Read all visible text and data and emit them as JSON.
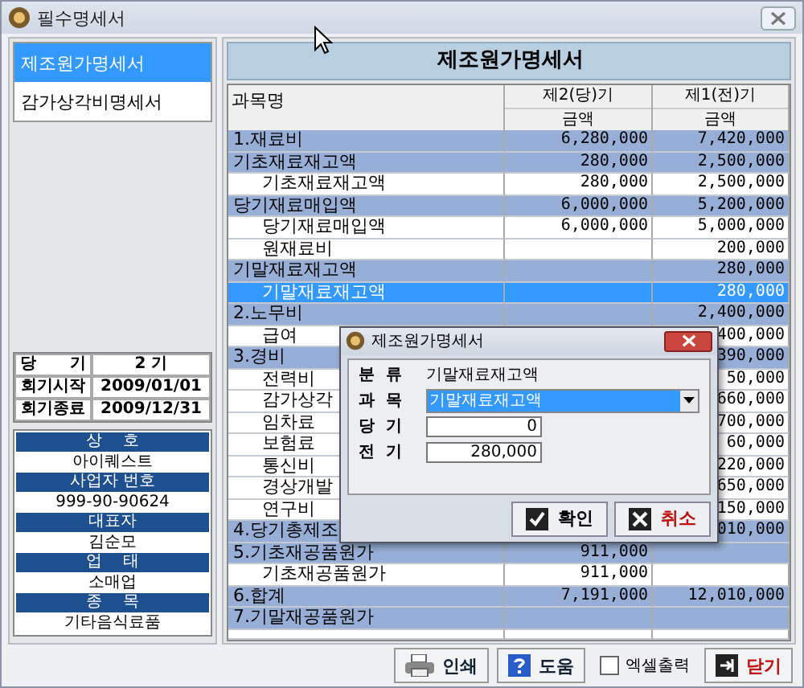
{
  "window": {
    "title": "필수명세서"
  },
  "statements": [
    {
      "label": "제조원가명세서",
      "selected": true
    },
    {
      "label": "감가상각비명세서",
      "selected": false
    }
  ],
  "period": [
    {
      "label": "당      기",
      "value": "2 기"
    },
    {
      "label": "회기시작",
      "value": "2009/01/01"
    },
    {
      "label": "회기종료",
      "value": "2009/12/31"
    }
  ],
  "company": [
    {
      "heading": "상    호",
      "value": "아이퀘스트"
    },
    {
      "heading": "사업자 번호",
      "value": "999-90-90624"
    },
    {
      "heading": "대표자",
      "value": "김순모"
    },
    {
      "heading": "업    태",
      "value": "소매업"
    },
    {
      "heading": "종    목",
      "value": "기타음식료품"
    }
  ],
  "table": {
    "title": "제조원가명세서",
    "name_header": "과목명",
    "columns": [
      {
        "period": "제2(당)기",
        "sub": "금액"
      },
      {
        "period": "제1(전)기",
        "sub": "금액"
      }
    ],
    "rows": [
      {
        "kind": "group",
        "label": "1.재료비",
        "current": "6,280,000",
        "previous": "7,420,000",
        "selected": false
      },
      {
        "kind": "group",
        "label": "기초재료재고액",
        "current": "280,000",
        "previous": "2,500,000",
        "selected": false
      },
      {
        "kind": "item",
        "label": "기초재료재고액",
        "current": "280,000",
        "previous": "2,500,000",
        "selected": false
      },
      {
        "kind": "group",
        "label": "당기재료매입액",
        "current": "6,000,000",
        "previous": "5,200,000",
        "selected": false
      },
      {
        "kind": "item",
        "label": "당기재료매입액",
        "current": "6,000,000",
        "previous": "5,000,000",
        "selected": false
      },
      {
        "kind": "item",
        "label": "원재료비",
        "previous": "200,000",
        "selected": false
      },
      {
        "kind": "group",
        "label": "기말재료재고액",
        "previous": "280,000",
        "selected": false
      },
      {
        "kind": "item",
        "label": "기말재료재고액",
        "previous": "280,000",
        "selected": true
      },
      {
        "kind": "group",
        "label": "2.노무비",
        "previous": "2,400,000",
        "selected": false
      },
      {
        "kind": "item",
        "label": "급여",
        "previous": "400,000",
        "selected": false
      },
      {
        "kind": "group",
        "label": "3.경비",
        "previous": "390,000",
        "selected": false
      },
      {
        "kind": "item",
        "label": "전력비",
        "previous": "50,000",
        "selected": false
      },
      {
        "kind": "item",
        "label": "감가상각",
        "previous": "660,000",
        "selected": false
      },
      {
        "kind": "item",
        "label": "임차료",
        "previous": "700,000",
        "selected": false
      },
      {
        "kind": "item",
        "label": "보험료",
        "previous": "60,000",
        "selected": false
      },
      {
        "kind": "item",
        "label": "통신비",
        "previous": "220,000",
        "selected": false
      },
      {
        "kind": "item",
        "label": "경상개발",
        "previous": "650,000",
        "selected": false
      },
      {
        "kind": "item",
        "label": "연구비",
        "previous": "150,000",
        "selected": false
      },
      {
        "kind": "group",
        "label": "4.당기총제조",
        "previous": "010,000",
        "selected": false
      },
      {
        "kind": "group",
        "label": "5.기초재공품원가",
        "current": "911,000",
        "selected": false
      },
      {
        "kind": "item",
        "label": "기초재공품원가",
        "current": "911,000",
        "selected": false
      },
      {
        "kind": "group",
        "label": "6.합계",
        "current": "7,191,000",
        "previous": "12,010,000",
        "selected": false
      },
      {
        "kind": "group",
        "label": "7.기말재공품원가",
        "selected": false
      }
    ]
  },
  "dialog": {
    "title": "제조원가명세서",
    "category_label": "분  류",
    "category": "기말재료재고액",
    "account_label": "과  목",
    "account": "기말재료재고액",
    "current_label": "당  기",
    "current": "0",
    "previous_label": "전  기",
    "previous": "280,000",
    "ok": "확인",
    "cancel": "취소"
  },
  "toolbar": {
    "print": "인쇄",
    "help": "도움",
    "excel": {
      "label": "엑셀출력",
      "checked": false
    },
    "close": "닫기"
  }
}
